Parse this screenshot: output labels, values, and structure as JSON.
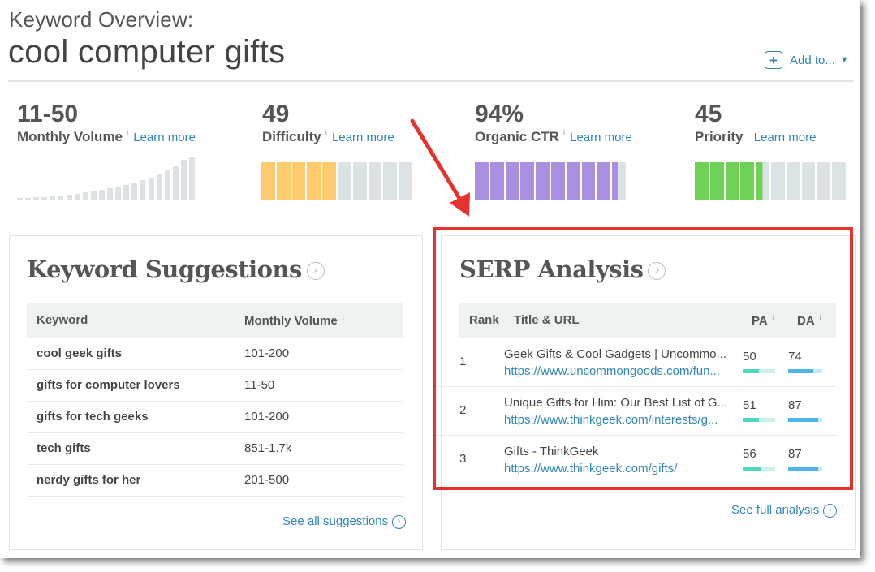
{
  "header": {
    "subtitle": "Keyword Overview:",
    "keyword": "cool computer gifts",
    "add_to_label": "Add to...",
    "add_icon": "plus-icon",
    "caret_icon": "caret-down-icon"
  },
  "metrics": [
    {
      "value": "11-50",
      "label": "Monthly Volume",
      "info": "i",
      "learn": "Learn more"
    },
    {
      "value": "49",
      "label": "Difficulty",
      "info": "i",
      "learn": "Learn more"
    },
    {
      "value": "94%",
      "label": "Organic CTR",
      "info": "i",
      "learn": "Learn more"
    },
    {
      "value": "45",
      "label": "Priority",
      "info": "i",
      "learn": "Learn more"
    }
  ],
  "volume_bar_levels": [
    0.03,
    0.04,
    0.05,
    0.06,
    0.07,
    0.09,
    0.11,
    0.13,
    0.16,
    0.19,
    0.22,
    0.25,
    0.29,
    0.33,
    0.38,
    0.44,
    0.5,
    0.58,
    0.67,
    0.78,
    0.9,
    0.98
  ],
  "gauges": {
    "difficulty": {
      "filled": 5,
      "total": 10,
      "color": "#fdcb6b"
    },
    "ctr": {
      "filled": 9.4,
      "total": 10,
      "color": "#ab8fe0"
    },
    "priority": {
      "filled": 4.5,
      "total": 10,
      "color": "#6ed257"
    },
    "empty_color": "#dbe3e4"
  },
  "suggestions": {
    "title": "Keyword Suggestions",
    "icon": "chevron-circle-icon",
    "columns": [
      "Keyword",
      "Monthly Volume"
    ],
    "info": "i",
    "rows": [
      {
        "keyword": "cool geek gifts",
        "volume": "101-200"
      },
      {
        "keyword": "gifts for computer lovers",
        "volume": "11-50"
      },
      {
        "keyword": "gifts for tech geeks",
        "volume": "101-200"
      },
      {
        "keyword": "tech gifts",
        "volume": "851-1.7k"
      },
      {
        "keyword": "nerdy gifts for her",
        "volume": "201-500"
      }
    ],
    "see_all": "See all suggestions"
  },
  "serp": {
    "title": "SERP Analysis",
    "icon": "chevron-circle-icon",
    "columns": [
      "Rank",
      "Title & URL",
      "PA",
      "DA"
    ],
    "info": "i",
    "rows": [
      {
        "rank": "1",
        "title": "Geek Gifts & Cool Gadgets | Uncommo...",
        "url": "https://www.uncommongoods.com/fun...",
        "pa": "50",
        "da": "74"
      },
      {
        "rank": "2",
        "title": "Unique Gifts for Him: Our Best List of G...",
        "url": "https://www.thinkgeek.com/interests/g...",
        "pa": "51",
        "da": "87"
      },
      {
        "rank": "3",
        "title": "Gifts - ThinkGeek",
        "url": "https://www.thinkgeek.com/gifts/",
        "pa": "56",
        "da": "87"
      }
    ],
    "see_full": "See full analysis",
    "pa_color": "#4fd6be",
    "da_color": "#4db3e8"
  },
  "annotation": {
    "highlight_color": "#e5322d"
  }
}
